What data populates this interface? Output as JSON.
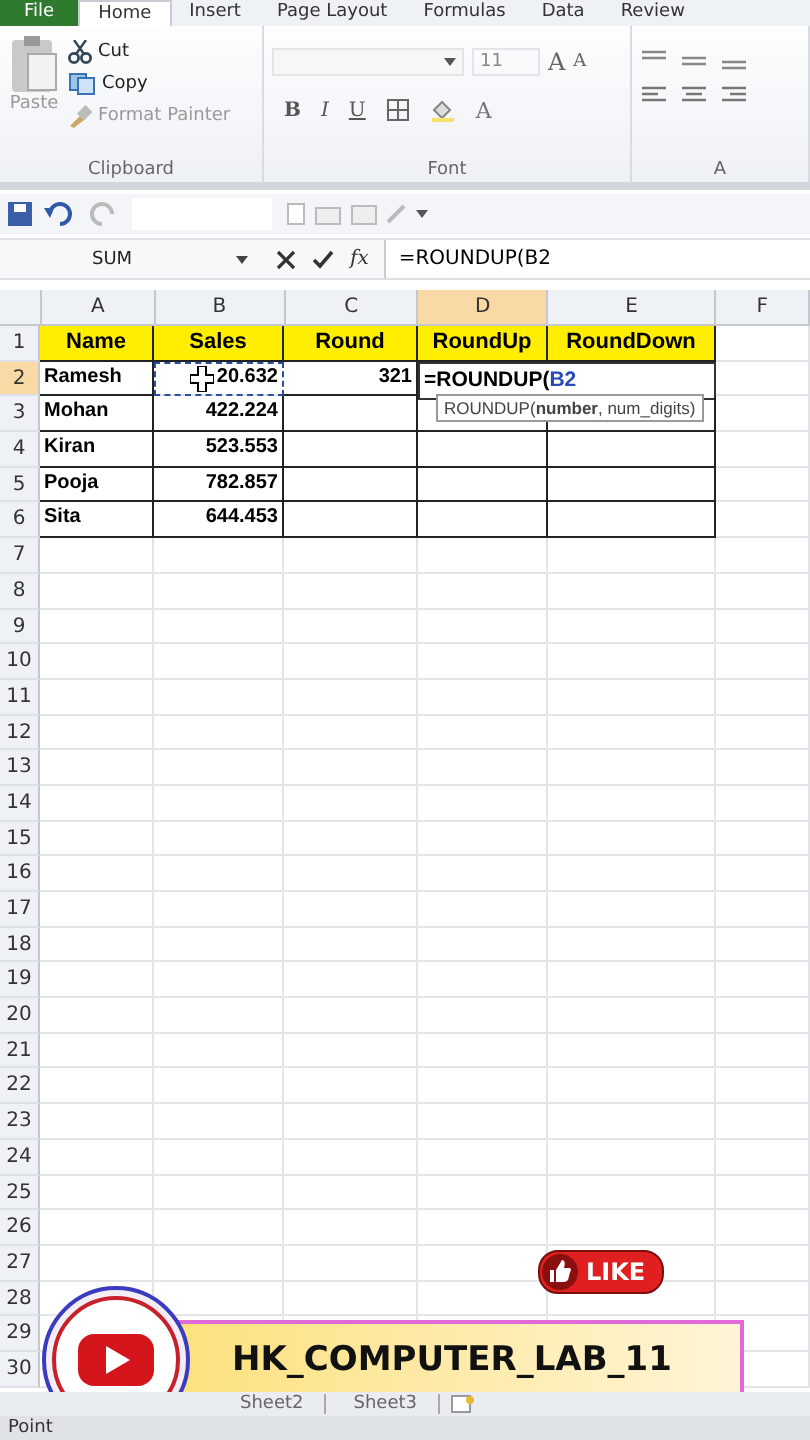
{
  "ribbon_tabs": [
    {
      "label": "File",
      "kind": "file",
      "selected": false
    },
    {
      "label": "Home",
      "kind": "tab",
      "selected": true
    },
    {
      "label": "Insert",
      "kind": "tab",
      "selected": false
    },
    {
      "label": "Page Layout",
      "kind": "tab",
      "selected": false
    },
    {
      "label": "Formulas",
      "kind": "tab",
      "selected": false
    },
    {
      "label": "Data",
      "kind": "tab",
      "selected": false
    },
    {
      "label": "Review",
      "kind": "tab",
      "selected": false
    }
  ],
  "clipboard": {
    "paste": {
      "label": "Paste",
      "disabled": true
    },
    "items": [
      {
        "kind": "cut",
        "label": "Cut",
        "disabled": false
      },
      {
        "kind": "copy",
        "label": "Copy",
        "disabled": false
      },
      {
        "kind": "painter",
        "label": "Format Painter",
        "disabled": true
      }
    ],
    "label": "Clipboard"
  },
  "font": {
    "size": "11",
    "bold": "B",
    "italic": "I",
    "underline": "U",
    "color_letter": "A",
    "grow": "A",
    "shrink": "A",
    "label": "Font"
  },
  "alignment": {
    "label": "A"
  },
  "name_box": "SUM",
  "fx": "fx",
  "formula": "=ROUNDUP(B2",
  "columns": [
    {
      "label": "A",
      "selected": false
    },
    {
      "label": "B",
      "selected": false
    },
    {
      "label": "C",
      "selected": false
    },
    {
      "label": "D",
      "selected": true
    },
    {
      "label": "E",
      "selected": false
    },
    {
      "label": "F",
      "selected": false
    }
  ],
  "rows": [
    {
      "n": "1",
      "selected": false,
      "cells": [
        {
          "kind": "header",
          "text": "Name"
        },
        {
          "kind": "header",
          "text": "Sales"
        },
        {
          "kind": "header",
          "text": "Round"
        },
        {
          "kind": "header",
          "text": "RoundUp"
        },
        {
          "kind": "header",
          "text": "RoundDown"
        }
      ]
    },
    {
      "n": "2",
      "selected": true,
      "cells": [
        {
          "kind": "text",
          "text": "Ramesh"
        },
        {
          "kind": "copied",
          "text": "20.632"
        },
        {
          "kind": "number",
          "text": "321"
        },
        {
          "kind": "formula",
          "text": "=ROUNDUP(",
          "ref": "B2"
        }
      ]
    },
    {
      "n": "3",
      "selected": false,
      "cells": [
        {
          "kind": "text",
          "text": "Mohan"
        },
        {
          "kind": "number",
          "text": "422.224"
        }
      ]
    },
    {
      "n": "4",
      "selected": false,
      "cells": [
        {
          "kind": "text",
          "text": "Kiran"
        },
        {
          "kind": "number",
          "text": "523.553"
        }
      ]
    },
    {
      "n": "5",
      "selected": false,
      "cells": [
        {
          "kind": "text",
          "text": "Pooja"
        },
        {
          "kind": "number",
          "text": "782.857"
        }
      ]
    },
    {
      "n": "6",
      "selected": false,
      "cells": [
        {
          "kind": "text",
          "text": "Sita"
        },
        {
          "kind": "number",
          "text": "644.453"
        }
      ]
    },
    {
      "n": "7",
      "selected": false
    },
    {
      "n": "8",
      "selected": false
    },
    {
      "n": "9",
      "selected": false
    },
    {
      "n": "10",
      "selected": false
    },
    {
      "n": "11",
      "selected": false
    },
    {
      "n": "12",
      "selected": false
    },
    {
      "n": "13",
      "selected": false
    },
    {
      "n": "14",
      "selected": false
    },
    {
      "n": "15",
      "selected": false
    },
    {
      "n": "16",
      "selected": false
    },
    {
      "n": "17",
      "selected": false
    },
    {
      "n": "18",
      "selected": false
    },
    {
      "n": "19",
      "selected": false
    },
    {
      "n": "20",
      "selected": false
    },
    {
      "n": "21",
      "selected": false
    },
    {
      "n": "22",
      "selected": false
    },
    {
      "n": "23",
      "selected": false
    },
    {
      "n": "24",
      "selected": false
    },
    {
      "n": "25",
      "selected": false
    },
    {
      "n": "26",
      "selected": false
    },
    {
      "n": "27",
      "selected": false
    },
    {
      "n": "28",
      "selected": false
    },
    {
      "n": "29",
      "selected": false
    },
    {
      "n": "30",
      "selected": false
    }
  ],
  "tooltip": "ROUNDUP(**number**, num_digits)",
  "sheet_tabs": [
    "Sheet2",
    "Sheet3"
  ],
  "status_bar": "Point",
  "overlay": {
    "like": "LIKE",
    "channel": "HK_COMPUTER_LAB_11"
  }
}
